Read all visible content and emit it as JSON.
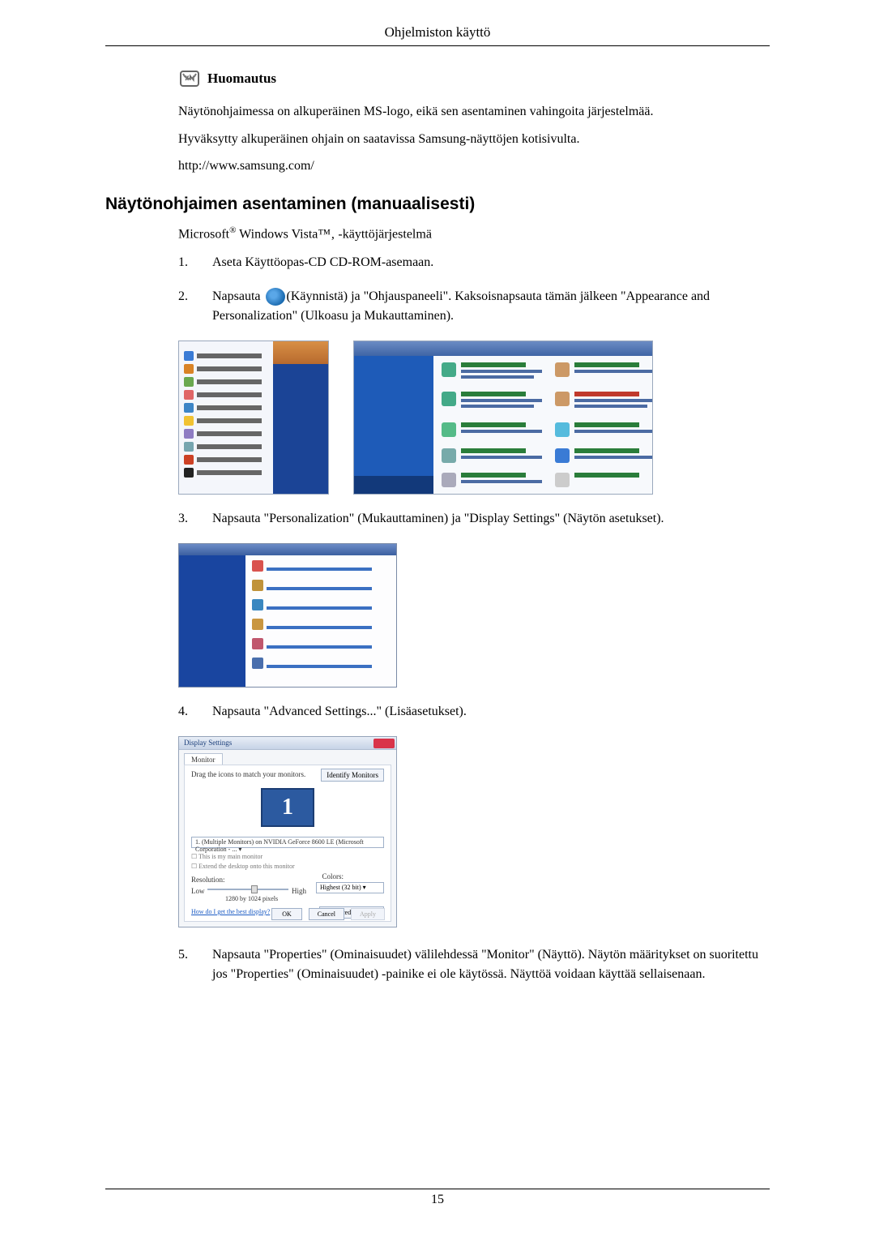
{
  "header": {
    "title": "Ohjelmiston käyttö"
  },
  "note": {
    "title": "Huomautus",
    "line1": "Näytönohjaimessa on alkuperäinen MS-logo, eikä sen asentaminen vahingoita järjestelmää.",
    "line2": "Hyväksytty alkuperäinen ohjain on saatavissa Samsung-näyttöjen kotisivulta.",
    "line3": "http://www.samsung.com/"
  },
  "section": {
    "heading": "Näytönohjaimen asentaminen (manuaalisesti)",
    "subtext_prefix": "Microsoft",
    "subtext_reg": "®",
    "subtext_mid": " Windows Vista™",
    "subtext_suffix": "‚ -käyttöjärjestelmä"
  },
  "steps": {
    "s1": {
      "num": "1.",
      "text": "Aseta Käyttöopas-CD CD-ROM-asemaan."
    },
    "s2": {
      "num": "2.",
      "pre": "Napsauta ",
      "post": "(Käynnistä) ja \"Ohjauspaneeli\". Kaksoisnapsauta tämän jälkeen \"Appearance and Personalization\" (Ulkoasu ja Mukauttaminen)."
    },
    "s3": {
      "num": "3.",
      "text": "Napsauta \"Personalization\" (Mukauttaminen) ja \"Display Settings\" (Näytön asetukset)."
    },
    "s4": {
      "num": "4.",
      "text": "Napsauta \"Advanced Settings...\" (Lisäasetukset)."
    },
    "s5": {
      "num": "5.",
      "text": "Napsauta \"Properties\" (Ominaisuudet) välilehdessä \"Monitor\" (Näyttö). Näytön määritykset on suoritettu jos \"Properties\" (Ominaisuudet) -painike ei ole käytössä. Näyttöä voidaan käyttää sellaisenaan."
    }
  },
  "display_settings": {
    "title": "Display Settings",
    "tab": "Monitor",
    "drag_label": "Drag the icons to match your monitors.",
    "identify_btn": "Identify Monitors",
    "monitor_num": "1",
    "combo": "1. (Multiple Monitors) on NVIDIA GeForce 8600 LE (Microsoft Corporation - ... ▾",
    "chk1": "This is my main monitor",
    "chk2": "Extend the desktop onto this monitor",
    "res_label": "Resolution:",
    "low": "Low",
    "high": "High",
    "res_value": "1280 by 1024 pixels",
    "colors_label": "Colors:",
    "colors_value": "Highest (32 bit)    ▾",
    "help_link": "How do I get the best display?",
    "adv_btn": "Advanced Settings...",
    "ok": "OK",
    "cancel": "Cancel",
    "apply": "Apply"
  },
  "footer": {
    "page": "15"
  }
}
